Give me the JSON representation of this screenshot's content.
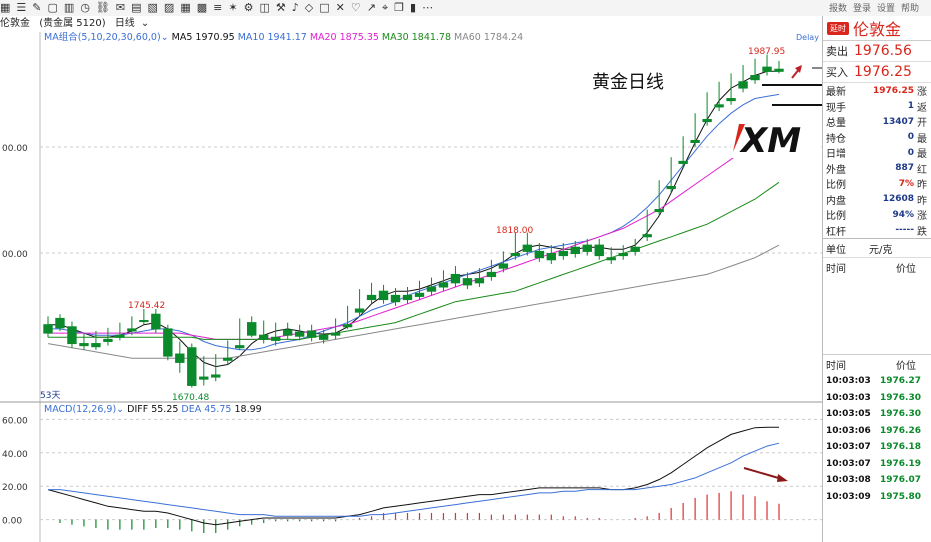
{
  "toolbar": {
    "icons": [
      "grid",
      "list",
      "edit",
      "window",
      "bars",
      "clock",
      "link",
      "mail",
      "note",
      "note2",
      "note3",
      "table",
      "chart",
      "menu",
      "star",
      "settings",
      "layers",
      "tool",
      "bell",
      "shape",
      "square",
      "cross",
      "heart",
      "arrow",
      "pin",
      "pages",
      "bars2",
      "more"
    ],
    "right_labels": [
      "报数",
      "登录",
      "设置",
      "帮助"
    ]
  },
  "header": {
    "symbol": "伦敦金",
    "group": "(贵金属 5120)",
    "period": "日线"
  },
  "ma_legend": {
    "label": "MA组合(5,10,20,30,60,0)",
    "items": [
      {
        "name": "MA5",
        "value": "1970.95",
        "color": "#111111"
      },
      {
        "name": "MA10",
        "value": "1941.17",
        "color": "#3b6fd6"
      },
      {
        "name": "MA20",
        "value": "1875.35",
        "color": "#e020d0"
      },
      {
        "name": "MA30",
        "value": "1841.78",
        "color": "#1a8a1a"
      },
      {
        "name": "MA60",
        "value": "1784.24",
        "color": "#888888"
      }
    ],
    "delay": "Delay"
  },
  "price_axis": [
    "00.00",
    "00.00"
  ],
  "annotations": {
    "high1": "1987.95",
    "mid": "1818.00",
    "left_high": "1745.42",
    "low": "1670.48",
    "days": "53天"
  },
  "overlay_title": "黄金日线",
  "macd_legend": {
    "label": "MACD(12,26,9)",
    "diff": "DIFF 55.25",
    "dea": "DEA 45.75",
    "macd": "18.99"
  },
  "macd_axis": [
    "60.00",
    "40.00",
    "20.00",
    "0.00"
  ],
  "quote_panel": {
    "badge": "延时",
    "name": "伦敦金",
    "sell_label": "卖出",
    "sell": "1976.56",
    "buy_label": "买入",
    "buy": "1976.25",
    "rows": [
      {
        "label": "最新",
        "value": "1976.25",
        "red": true,
        "ext": "涨"
      },
      {
        "label": "现手",
        "value": "1",
        "red": false,
        "ext": "返"
      },
      {
        "label": "总量",
        "value": "13407",
        "red": false,
        "ext": "开"
      },
      {
        "label": "持仓",
        "value": "0",
        "red": false,
        "ext": "最"
      },
      {
        "label": "日增",
        "value": "0",
        "red": false,
        "ext": "最"
      },
      {
        "label": "外盘",
        "value": "887",
        "red": false,
        "ext": "红"
      },
      {
        "label": "比例",
        "value": "7%",
        "red": true,
        "ext": "昨"
      },
      {
        "label": "内盘",
        "value": "12608",
        "red": false,
        "ext": "昨"
      },
      {
        "label": "比例",
        "value": "94%",
        "red": false,
        "ext": "涨"
      },
      {
        "label": "杠杆",
        "value": "-----",
        "red": false,
        "ext": "跌"
      }
    ],
    "unit_label": "单位",
    "unit_value": "元/克",
    "time_label": "时间",
    "price_label": "价位",
    "ticks": [
      {
        "time": "10:03:03",
        "price": "1976.27"
      },
      {
        "time": "10:03:03",
        "price": "1976.30"
      },
      {
        "time": "10:03:05",
        "price": "1976.30"
      },
      {
        "time": "10:03:06",
        "price": "1976.26"
      },
      {
        "time": "10:03:07",
        "price": "1976.18"
      },
      {
        "time": "10:03:07",
        "price": "1976.19"
      },
      {
        "time": "10:03:08",
        "price": "1976.07"
      },
      {
        "time": "10:03:09",
        "price": "1975.80"
      }
    ]
  },
  "chart_data": {
    "type": "candlestick",
    "up_color": "#e03030",
    "down_color": "#0a8a2a",
    "ylim": [
      1660,
      2000
    ],
    "candles": [
      [
        1730,
        1738,
        1722,
        1718
      ],
      [
        1736,
        1740,
        1727,
        1724
      ],
      [
        1728,
        1733,
        1712,
        1708
      ],
      [
        1712,
        1722,
        1710,
        1706
      ],
      [
        1712,
        1724,
        1709,
        1706
      ],
      [
        1716,
        1727,
        1714,
        1710
      ],
      [
        1720,
        1732,
        1718,
        1715
      ],
      [
        1726,
        1738,
        1724,
        1720
      ],
      [
        1734,
        1745,
        1733,
        1730
      ],
      [
        1740,
        1745,
        1726,
        1722
      ],
      [
        1726,
        1730,
        1700,
        1696
      ],
      [
        1702,
        1714,
        1694,
        1684
      ],
      [
        1708,
        1712,
        1672,
        1670
      ],
      [
        1680,
        1700,
        1678,
        1672
      ],
      [
        1682,
        1702,
        1680,
        1676
      ],
      [
        1698,
        1715,
        1696,
        1692
      ],
      [
        1710,
        1736,
        1708,
        1706
      ],
      [
        1732,
        1738,
        1720,
        1718
      ],
      [
        1720,
        1734,
        1716,
        1712
      ],
      [
        1718,
        1732,
        1715,
        1710
      ],
      [
        1725,
        1732,
        1720,
        1716
      ],
      [
        1723,
        1730,
        1719,
        1715
      ],
      [
        1724,
        1730,
        1718,
        1714
      ],
      [
        1720,
        1725,
        1716,
        1712
      ],
      [
        1722,
        1736,
        1720,
        1716
      ],
      [
        1730,
        1748,
        1728,
        1726
      ],
      [
        1745,
        1764,
        1742,
        1738
      ],
      [
        1758,
        1770,
        1754,
        1750
      ],
      [
        1762,
        1768,
        1754,
        1750
      ],
      [
        1758,
        1765,
        1752,
        1748
      ],
      [
        1758,
        1766,
        1754,
        1750
      ],
      [
        1760,
        1772,
        1757,
        1754
      ],
      [
        1766,
        1775,
        1762,
        1758
      ],
      [
        1770,
        1782,
        1766,
        1762
      ],
      [
        1778,
        1786,
        1770,
        1766
      ],
      [
        1774,
        1780,
        1768,
        1764
      ],
      [
        1774,
        1784,
        1770,
        1766
      ],
      [
        1780,
        1792,
        1776,
        1772
      ],
      [
        1788,
        1800,
        1784,
        1780
      ],
      [
        1798,
        1818,
        1796,
        1792
      ],
      [
        1806,
        1818,
        1800,
        1796
      ],
      [
        1800,
        1808,
        1794,
        1790
      ],
      [
        1798,
        1806,
        1792,
        1788
      ],
      [
        1800,
        1808,
        1796,
        1792
      ],
      [
        1804,
        1810,
        1798,
        1794
      ],
      [
        1806,
        1812,
        1800,
        1796
      ],
      [
        1806,
        1812,
        1796,
        1792
      ],
      [
        1794,
        1804,
        1792,
        1788
      ],
      [
        1798,
        1806,
        1796,
        1792
      ],
      [
        1804,
        1812,
        1800,
        1796
      ],
      [
        1816,
        1840,
        1814,
        1810
      ],
      [
        1840,
        1868,
        1838,
        1834
      ],
      [
        1862,
        1890,
        1860,
        1856
      ],
      [
        1886,
        1910,
        1884,
        1880
      ],
      [
        1906,
        1932,
        1904,
        1900
      ],
      [
        1926,
        1952,
        1924,
        1920
      ],
      [
        1940,
        1962,
        1938,
        1934
      ],
      [
        1946,
        1970,
        1944,
        1940
      ],
      [
        1962,
        1978,
        1956,
        1952
      ],
      [
        1968,
        1984,
        1964,
        1960
      ],
      [
        1976,
        1988,
        1972,
        1968
      ],
      [
        1974,
        1982,
        1972,
        1970
      ]
    ],
    "ma_series": {
      "MA5": [
        1730,
        1730,
        1726,
        1722,
        1718,
        1718,
        1720,
        1724,
        1730,
        1732,
        1726,
        1716,
        1704,
        1694,
        1690,
        1692,
        1700,
        1712,
        1720,
        1724,
        1726,
        1724,
        1722,
        1721,
        1722,
        1728,
        1738,
        1750,
        1758,
        1762,
        1762,
        1764,
        1768,
        1772,
        1776,
        1778,
        1780,
        1784,
        1790,
        1798,
        1804,
        1806,
        1804,
        1802,
        1802,
        1804,
        1804,
        1802,
        1802,
        1806,
        1818,
        1834,
        1856,
        1880,
        1904,
        1926,
        1944,
        1956,
        1962,
        1968,
        1972,
        1972
      ],
      "MA10": [
        1726,
        1726,
        1724,
        1722,
        1720,
        1720,
        1720,
        1722,
        1724,
        1726,
        1726,
        1724,
        1720,
        1714,
        1710,
        1708,
        1706,
        1706,
        1708,
        1712,
        1714,
        1716,
        1720,
        1724,
        1728,
        1732,
        1738,
        1744,
        1748,
        1752,
        1758,
        1762,
        1766,
        1770,
        1774,
        1778,
        1782,
        1786,
        1790,
        1794,
        1798,
        1802,
        1804,
        1806,
        1808,
        1810,
        1814,
        1818,
        1824,
        1832,
        1842,
        1854,
        1868,
        1882,
        1896,
        1910,
        1922,
        1932,
        1940,
        1946,
        1948,
        1950
      ],
      "MA20": [
        1722,
        1722,
        1722,
        1722,
        1722,
        1722,
        1722,
        1722,
        1722,
        1722,
        1722,
        1722,
        1720,
        1718,
        1716,
        1716,
        1716,
        1716,
        1716,
        1718,
        1720,
        1722,
        1724,
        1726,
        1728,
        1730,
        1734,
        1738,
        1742,
        1746,
        1750,
        1754,
        1758,
        1762,
        1766,
        1770,
        1774,
        1778,
        1782,
        1786,
        1790,
        1794,
        1798,
        1802,
        1806,
        1810,
        1814,
        1818,
        1822,
        1828,
        1834,
        1840,
        1848,
        1856,
        1864,
        1872,
        1880,
        1888,
        1896,
        1904,
        1912,
        1920
      ],
      "MA30": [
        1718,
        1718,
        1718,
        1718,
        1718,
        1718,
        1718,
        1718,
        1718,
        1718,
        1718,
        1718,
        1718,
        1716,
        1716,
        1716,
        1716,
        1716,
        1716,
        1716,
        1716,
        1716,
        1718,
        1720,
        1722,
        1724,
        1726,
        1728,
        1730,
        1732,
        1736,
        1740,
        1744,
        1748,
        1752,
        1754,
        1756,
        1758,
        1760,
        1762,
        1766,
        1770,
        1774,
        1778,
        1782,
        1786,
        1790,
        1794,
        1798,
        1802,
        1806,
        1810,
        1814,
        1818,
        1822,
        1826,
        1832,
        1838,
        1844,
        1850,
        1858,
        1866
      ],
      "MA60": [
        1712,
        1710,
        1708,
        1706,
        1704,
        1702,
        1700,
        1698,
        1698,
        1698,
        1698,
        1698,
        1698,
        1698,
        1698,
        1698,
        1700,
        1702,
        1704,
        1706,
        1708,
        1710,
        1712,
        1714,
        1716,
        1718,
        1720,
        1722,
        1724,
        1726,
        1728,
        1730,
        1732,
        1734,
        1736,
        1738,
        1740,
        1742,
        1744,
        1746,
        1748,
        1750,
        1752,
        1754,
        1756,
        1758,
        1760,
        1762,
        1764,
        1766,
        1768,
        1770,
        1772,
        1774,
        1776,
        1778,
        1782,
        1786,
        1790,
        1794,
        1800,
        1806
      ]
    },
    "macd": {
      "ylim": [
        -5,
        62
      ],
      "diff": [
        18,
        16,
        14,
        12,
        10,
        8,
        7,
        6,
        5,
        5,
        4,
        2,
        0,
        -2,
        -3,
        -2,
        -1,
        0,
        1,
        1,
        1,
        1,
        1,
        1,
        1,
        2,
        3,
        5,
        7,
        8,
        9,
        10,
        11,
        12,
        13,
        14,
        15,
        15,
        16,
        17,
        18,
        19,
        19,
        19,
        19,
        19,
        19,
        18,
        18,
        19,
        21,
        24,
        28,
        33,
        38,
        43,
        47,
        51,
        53,
        55,
        55.25,
        55.25
      ],
      "dea": [
        18,
        18,
        17,
        16,
        15,
        14,
        13,
        12,
        11,
        10,
        9,
        8,
        7,
        6,
        5,
        4,
        3,
        3,
        3,
        2,
        2,
        2,
        2,
        2,
        2,
        2,
        2,
        3,
        3,
        4,
        5,
        6,
        7,
        8,
        9,
        10,
        11,
        12,
        13,
        14,
        15,
        16,
        16,
        17,
        17,
        18,
        18,
        18,
        18,
        18,
        19,
        20,
        21,
        23,
        25,
        28,
        31,
        34,
        38,
        41,
        44,
        45.75
      ],
      "hist": [
        0,
        -2,
        -3,
        -4,
        -5,
        -6,
        -6,
        -6,
        -6,
        -5,
        -5,
        -6,
        -7,
        -8,
        -8,
        -6,
        -4,
        -3,
        -2,
        -1,
        -1,
        -1,
        -1,
        -1,
        -1,
        0,
        1,
        2,
        4,
        4,
        4,
        4,
        4,
        4,
        4,
        4,
        4,
        3,
        3,
        3,
        3,
        3,
        3,
        2,
        2,
        1,
        1,
        0,
        0,
        1,
        2,
        4,
        7,
        10,
        13,
        15,
        16,
        17,
        15,
        14,
        11,
        9.5
      ]
    }
  }
}
